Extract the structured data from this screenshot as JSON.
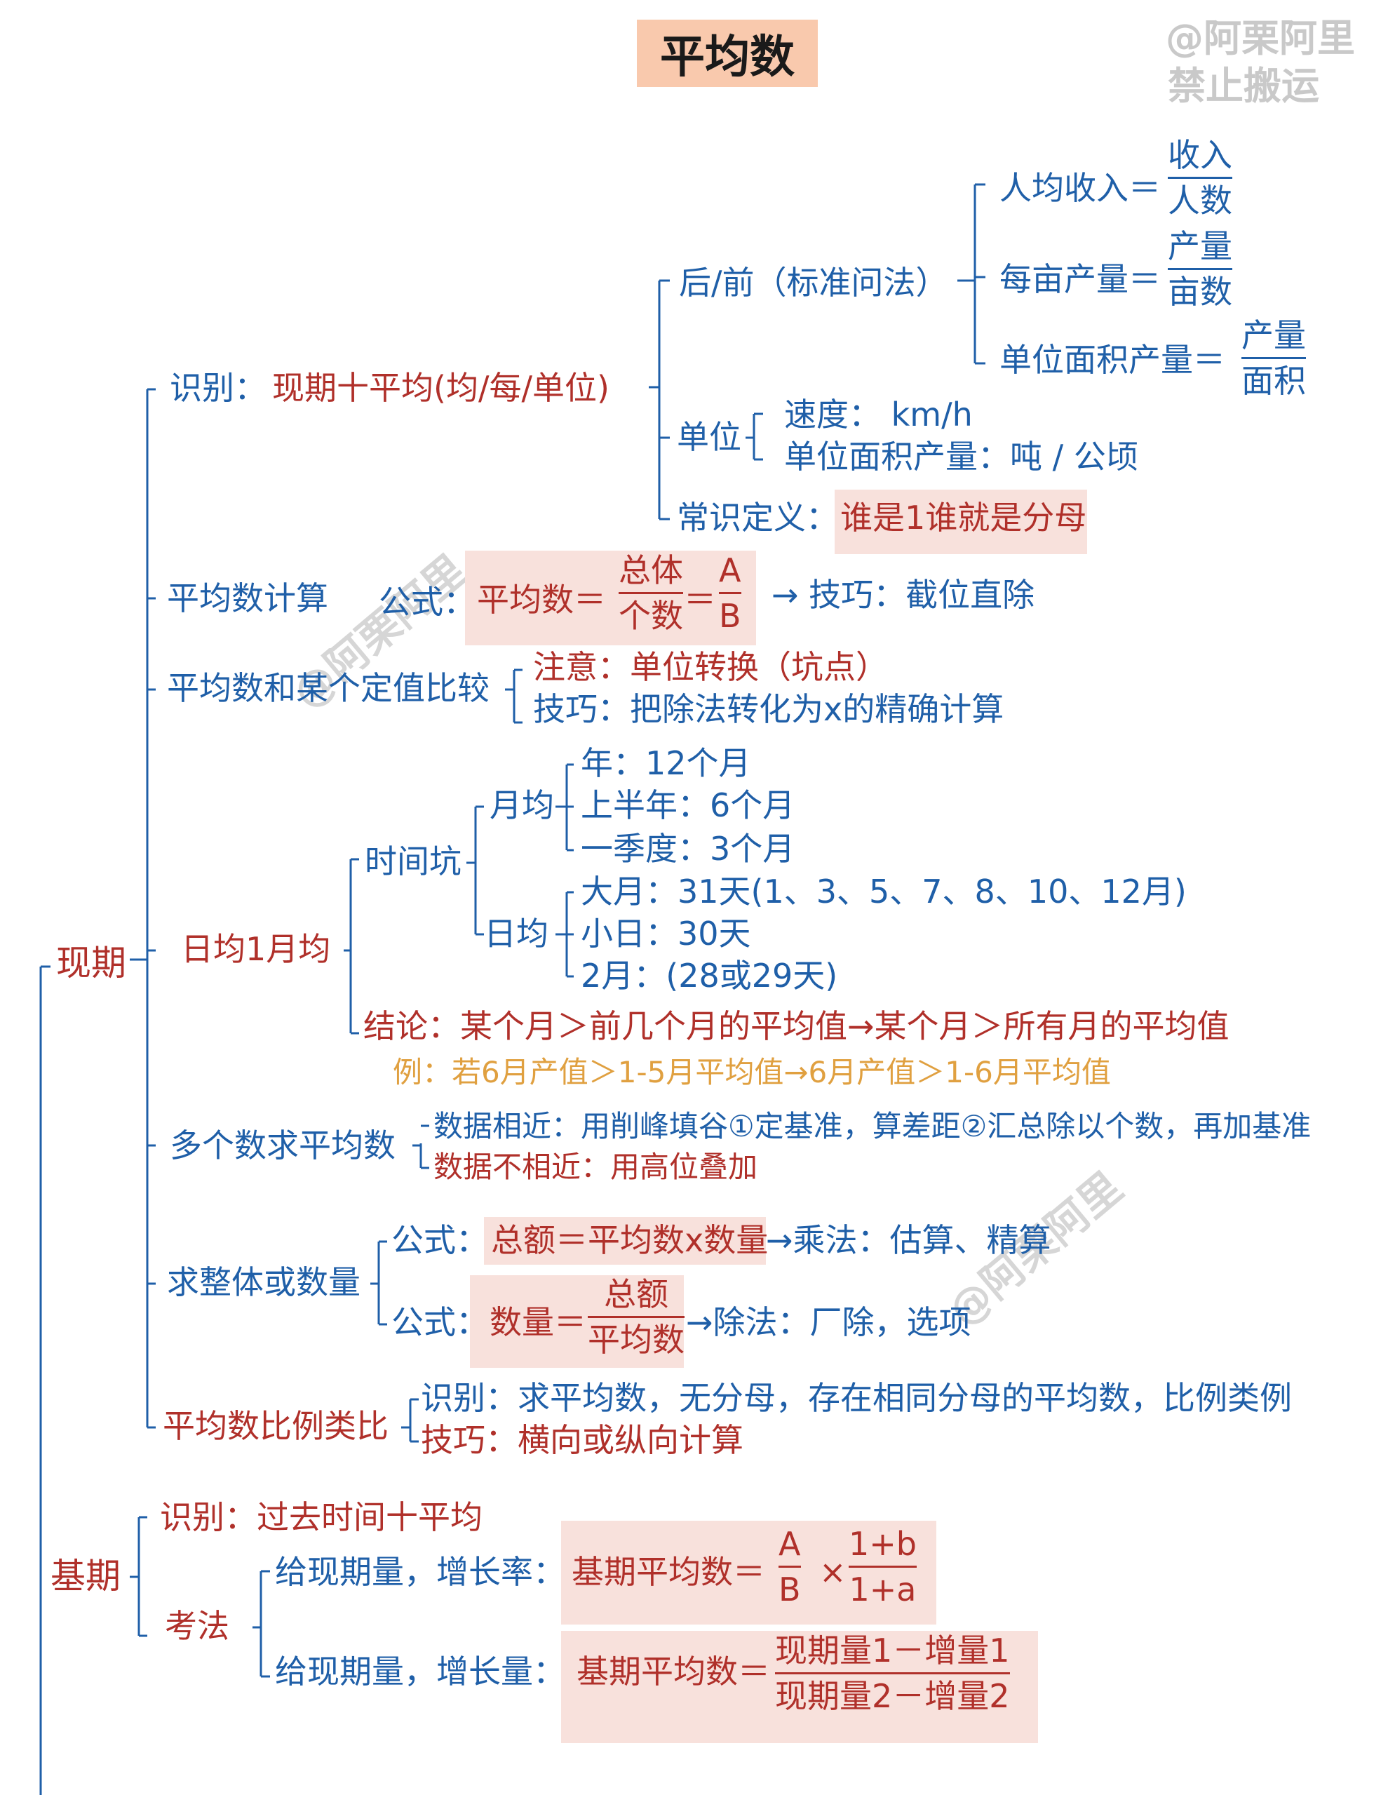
{
  "title": "平均数",
  "watermark": {
    "line1": "@阿栗阿里",
    "line2": "禁止搬运",
    "diagonal": "@阿栗阿里"
  },
  "current": {
    "label": "现期",
    "identify": {
      "label": "识别：",
      "value": "现期十平均(均/每/单位)",
      "after_before": {
        "label": "后/前（标准问法）",
        "items": [
          {
            "text": "人均收入＝",
            "num": "收入",
            "den": "人数"
          },
          {
            "text": "每亩产量＝",
            "num": "产量",
            "den": "亩数"
          },
          {
            "text": "单位面积产量＝",
            "num": "产量",
            "den": "面积"
          }
        ]
      },
      "unit": {
        "label": "单位",
        "items": [
          "速度： km/h",
          "单位面积产量：吨 / 公顷"
        ]
      },
      "common": {
        "label": "常识定义：",
        "value": "谁是1谁就是分母"
      }
    },
    "calc": {
      "label": "平均数计算",
      "formula_label": "公式：",
      "formula_lhs": "平均数＝",
      "f1_num": "总体",
      "f1_den": "个数",
      "eq": "＝",
      "f2_num": "A",
      "f2_den": "B",
      "tip": "→ 技巧：截位直除"
    },
    "compare": {
      "label": "平均数和某个定值比较",
      "note": "注意：单位转换（坑点）",
      "tip": "技巧：把除法转化为x的精确计算"
    },
    "daily": {
      "label": "日均1月均",
      "pitfall": "时间坑",
      "monthly": {
        "label": "月均",
        "items": [
          "年：12个月",
          "上半年：6个月",
          "一季度：3个月"
        ]
      },
      "dailyavg": {
        "label": "日均",
        "items": [
          "大月：31天(1、3、5、7、8、10、12月)",
          "小日：30天",
          "2月：(28或29天)"
        ]
      },
      "conclusion": "结论：某个月＞前几个月的平均值→某个月＞所有月的平均值",
      "example": "例：若6月产值＞1-5月平均值→6月产值＞1-6月平均值"
    },
    "multi": {
      "label": "多个数求平均数",
      "items": [
        "数据相近：用削峰填谷①定基准，算差距②汇总除以个数，再加基准",
        "数据不相近：用高位叠加"
      ]
    },
    "whole": {
      "label": "求整体或数量",
      "formula_label": "公式：",
      "f1": "总额＝平均数x数量",
      "f1_tip": "→乘法：估算、精算",
      "f2_lhs": "数量＝",
      "f2_num": "总额",
      "f2_den": "平均数",
      "f2_tip": "→除法：厂除，选项"
    },
    "ratio": {
      "label": "平均数比例类比",
      "identify": "识别：求平均数，无分母，存在相同分母的平均数，比例类例",
      "tip": "技巧：横向或纵向计算"
    }
  },
  "base": {
    "label": "基期",
    "identify": "识别：过去时间十平均",
    "method_label": "考法",
    "m1": {
      "label": "给现期量，增长率：",
      "lhs": "基期平均数＝",
      "a_num": "A",
      "a_den": "B",
      "times": "×",
      "b_num": "1+b",
      "b_den": "1+a"
    },
    "m2": {
      "label": "给现期量，增长量：",
      "lhs": "基期平均数＝",
      "num": "现期量1－增量1",
      "den": "现期量2－增量2"
    }
  },
  "colors": {
    "blue": "#1f5fa8",
    "red": "#b0302a",
    "orange": "#e0a040",
    "highlight": "#f8e1dc",
    "title_bg": "#f9c9ad"
  }
}
